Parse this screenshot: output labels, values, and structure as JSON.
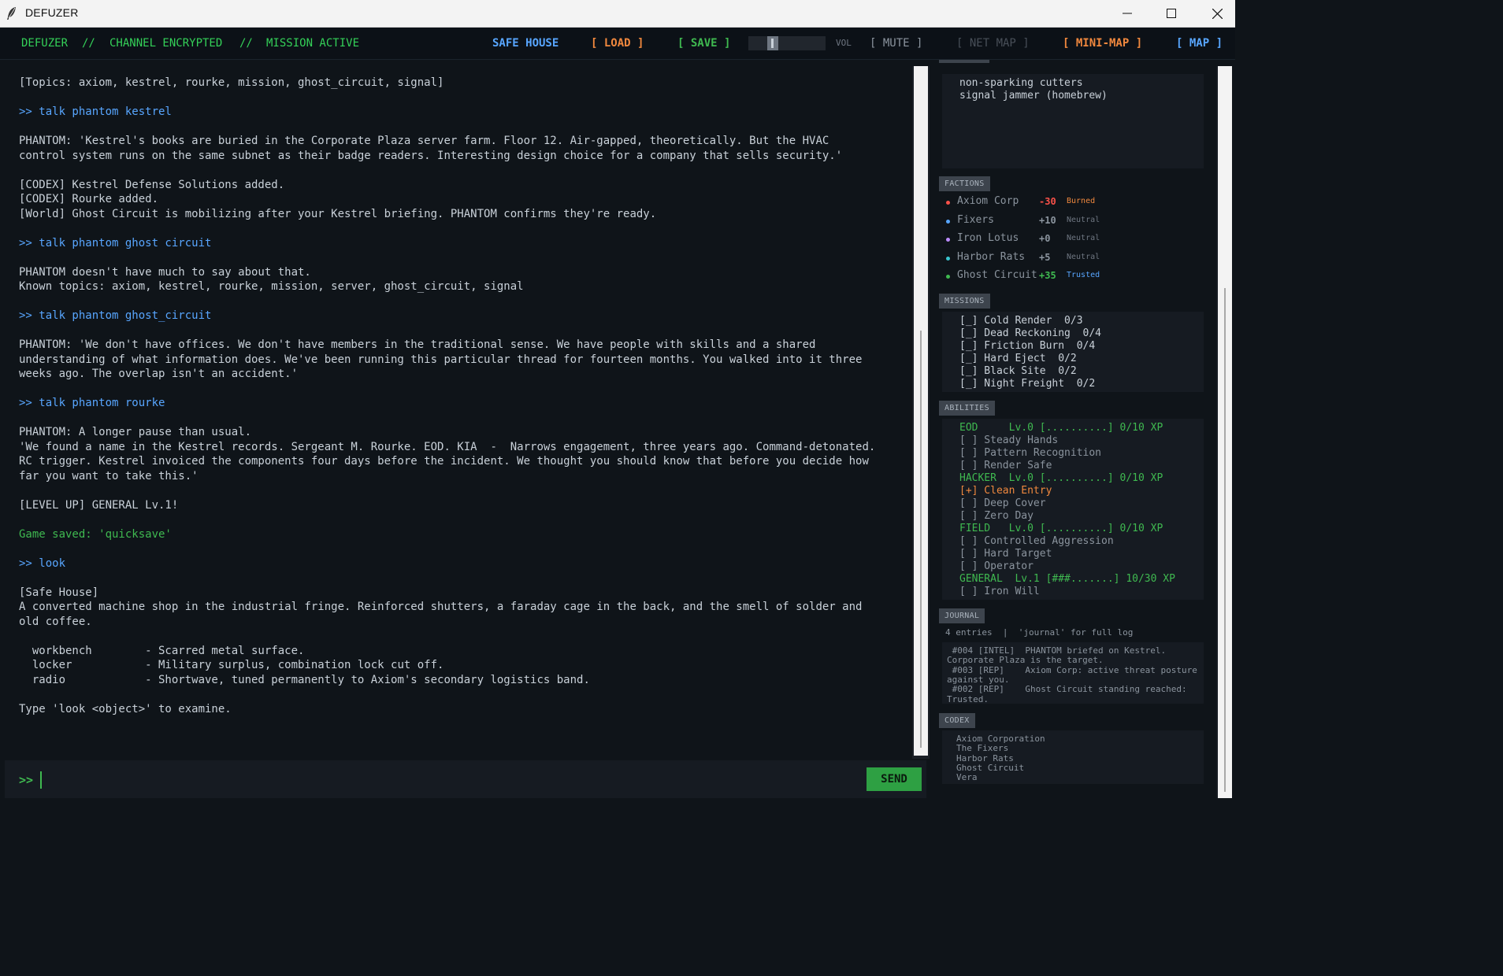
{
  "window": {
    "title": "DEFUZER"
  },
  "topbar": {
    "brand": "DEFUZER",
    "sep": "//",
    "channel": "CHANNEL ENCRYPTED",
    "mission": "MISSION ACTIVE",
    "location": "SAFE HOUSE",
    "load": "[ LOAD ]",
    "save": "[ SAVE ]",
    "vol": "VOL",
    "mute": "[ MUTE ]",
    "netmap": "[ NET MAP ]",
    "minimap": "[ MINI-MAP ]",
    "map": "[ MAP ]"
  },
  "output": [
    {
      "t": "[Topics: axiom, kestrel, rourke, mission, ghost_circuit, signal]"
    },
    {
      "t": ""
    },
    {
      "t": ">> talk phantom kestrel",
      "k": "cmd"
    },
    {
      "t": ""
    },
    {
      "t": "PHANTOM: 'Kestrel's books are buried in the Corporate Plaza server farm. Floor 12. Air-gapped, theoretically. But the HVAC"
    },
    {
      "t": "control system runs on the same subnet as their badge readers. Interesting design choice for a company that sells security.'"
    },
    {
      "t": ""
    },
    {
      "t": "[CODEX] Kestrel Defense Solutions added."
    },
    {
      "t": "[CODEX] Rourke added."
    },
    {
      "t": "[World] Ghost Circuit is mobilizing after your Kestrel briefing. PHANTOM confirms they're ready."
    },
    {
      "t": ""
    },
    {
      "t": ">> talk phantom ghost circuit",
      "k": "cmd"
    },
    {
      "t": ""
    },
    {
      "t": "PHANTOM doesn't have much to say about that."
    },
    {
      "t": "Known topics: axiom, kestrel, rourke, mission, server, ghost_circuit, signal"
    },
    {
      "t": ""
    },
    {
      "t": ">> talk phantom ghost_circuit",
      "k": "cmd"
    },
    {
      "t": ""
    },
    {
      "t": "PHANTOM: 'We don't have offices. We don't have members in the traditional sense. We have people with skills and a shared"
    },
    {
      "t": "understanding of what information does. We've been running this particular thread for fourteen months. You walked into it three"
    },
    {
      "t": "weeks ago. The overlap isn't an accident.'"
    },
    {
      "t": ""
    },
    {
      "t": ">> talk phantom rourke",
      "k": "cmd"
    },
    {
      "t": ""
    },
    {
      "t": "PHANTOM: A longer pause than usual."
    },
    {
      "t": "'We found a name in the Kestrel records. Sergeant M. Rourke. EOD. KIA  -  Narrows engagement, three years ago. Command-detonated."
    },
    {
      "t": "RC trigger. Kestrel invoiced the components four days before the incident. We thought you should know that before you decide how"
    },
    {
      "t": "far you want to take this.'"
    },
    {
      "t": ""
    },
    {
      "t": "[LEVEL UP] GENERAL Lv.1!"
    },
    {
      "t": ""
    },
    {
      "t": "Game saved: 'quicksave'",
      "k": "ok"
    },
    {
      "t": ""
    },
    {
      "t": ">> look",
      "k": "cmd"
    },
    {
      "t": ""
    },
    {
      "t": "[Safe House]"
    },
    {
      "t": "A converted machine shop in the industrial fringe. Reinforced shutters, a faraday cage in the back, and the smell of solder and"
    },
    {
      "t": "old coffee."
    },
    {
      "t": ""
    },
    {
      "t": "  workbench        - Scarred metal surface."
    },
    {
      "t": "  locker           - Military surplus, combination lock cut off."
    },
    {
      "t": "  radio            - Shortwave, tuned permanently to Axiom's secondary logistics band."
    },
    {
      "t": ""
    },
    {
      "t": "Type 'look <object>' to examine."
    }
  ],
  "input": {
    "prompt": ">>",
    "value": "",
    "send": "SEND"
  },
  "inventory": {
    "items": [
      "non-sparking cutters",
      "signal jammer (homebrew)"
    ]
  },
  "factions": {
    "header": "FACTIONS",
    "items": [
      {
        "name": "Axiom Corp",
        "value": "-30",
        "status": "Burned",
        "dot": "#f85149",
        "vcolor": "#f85149",
        "scolor": "#f0883e"
      },
      {
        "name": "Fixers",
        "value": "+10",
        "status": "Neutral",
        "dot": "#58a6ff",
        "vcolor": "#8b949e",
        "scolor": "#6e7681"
      },
      {
        "name": "Iron Lotus",
        "value": "+0",
        "status": "Neutral",
        "dot": "#bc8cff",
        "vcolor": "#8b949e",
        "scolor": "#6e7681"
      },
      {
        "name": "Harbor Rats",
        "value": "+5",
        "status": "Neutral",
        "dot": "#39c5cf",
        "vcolor": "#8b949e",
        "scolor": "#6e7681"
      },
      {
        "name": "Ghost Circuit",
        "value": "+35",
        "status": "Trusted",
        "dot": "#3fb950",
        "vcolor": "#3fb950",
        "scolor": "#58a6ff"
      }
    ]
  },
  "missions": {
    "header": "MISSIONS",
    "items": [
      "[_] Cold Render  0/3",
      "[_] Dead Reckoning  0/4",
      "[_] Friction Burn  0/4",
      "[_] Hard Eject  0/2",
      "[_] Black Site  0/2",
      "[_] Night Freight  0/2"
    ]
  },
  "abilities": {
    "header": "ABILITIES",
    "lines": [
      {
        "t": "EOD     Lv.0 [..........] 0/10 XP",
        "k": "tree"
      },
      {
        "t": "[ ] Steady Hands"
      },
      {
        "t": "[ ] Pattern Recognition"
      },
      {
        "t": "[ ] Render Safe"
      },
      {
        "t": "HACKER  Lv.0 [..........] 0/10 XP",
        "k": "tree"
      },
      {
        "t": "[+] Clean Entry",
        "k": "owned"
      },
      {
        "t": "[ ] Deep Cover"
      },
      {
        "t": "[ ] Zero Day"
      },
      {
        "t": "FIELD   Lv.0 [..........] 0/10 XP",
        "k": "tree"
      },
      {
        "t": "[ ] Controlled Aggression"
      },
      {
        "t": "[ ] Hard Target"
      },
      {
        "t": "[ ] Operator"
      },
      {
        "t": "GENERAL  Lv.1 [###.......] 10/30 XP",
        "k": "tree"
      },
      {
        "t": "[ ] Iron Will"
      }
    ]
  },
  "journal": {
    "header": "JOURNAL",
    "summary": "4 entries  |  'journal' for full log",
    "lines": [
      " #004 [INTEL]  PHANTOM briefed on Kestrel.",
      "Corporate Plaza is the target.",
      " #003 [REP]    Axiom Corp: active threat posture",
      "against you.",
      " #002 [REP]    Ghost Circuit standing reached:",
      "Trusted."
    ]
  },
  "codex": {
    "header": "CODEX",
    "items": [
      "Axiom Corporation",
      "The Fixers",
      "Harbor Rats",
      "Ghost Circuit",
      "Vera"
    ]
  },
  "colors": {
    "bg": "#0f1419",
    "accent_green": "#3fb950",
    "accent_blue": "#58a6ff",
    "accent_orange": "#f0883e"
  }
}
